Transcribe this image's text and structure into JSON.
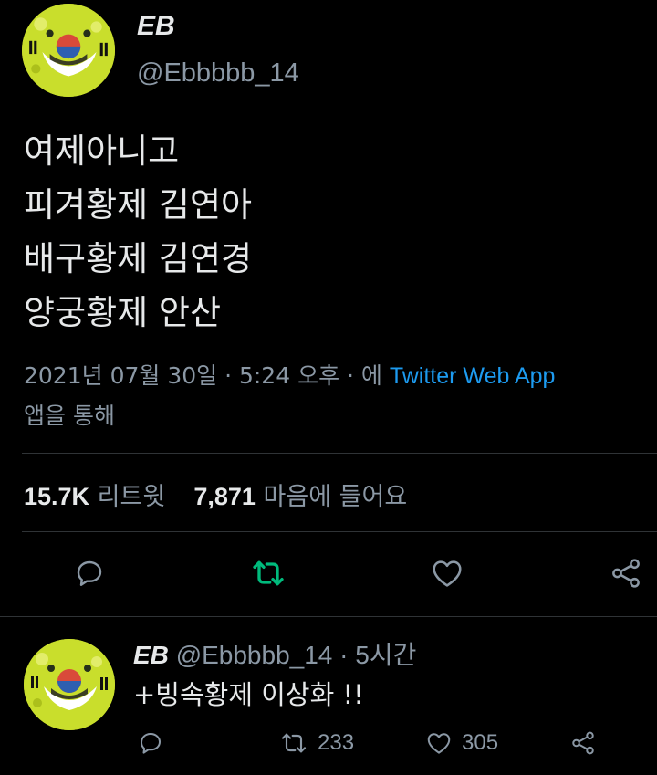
{
  "tweet": {
    "author_name": "EB",
    "author_handle": "@Ebbbbb_14",
    "text_lines": [
      "여제아니고",
      "피겨황제 김연아",
      "배구황제 김연경",
      "양궁황제 안산"
    ],
    "timestamp": "2021년 07월 30일 · 5:24 오후 · 에 ",
    "source": "Twitter Web App",
    "source_suffix": "앱을 통해",
    "retweet_count": "15.7K",
    "retweet_label": "리트윗",
    "like_count": "7,871",
    "like_label": "마음에 들어요",
    "colors": {
      "background": "#000000",
      "text": "#e7e9ea",
      "secondary": "#8b98a5",
      "link": "#1d9bf0",
      "retweet_active": "#00ba7c",
      "divider": "#2f3336"
    },
    "icons": [
      "reply-icon",
      "retweet-icon",
      "like-icon",
      "share-icon"
    ]
  },
  "reply": {
    "author_name": "EB",
    "author_handle": "@Ebbbbb_14",
    "time_separator": " · ",
    "time_ago": "5시간",
    "text": "+빙속황제 이상화 !!",
    "retweet_count": "233",
    "like_count": "305"
  }
}
